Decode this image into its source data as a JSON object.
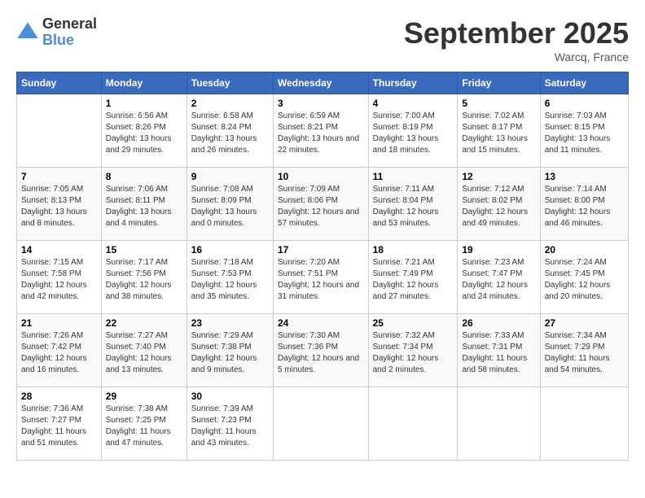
{
  "logo": {
    "general": "General",
    "blue": "Blue"
  },
  "title": "September 2025",
  "location": "Warcq, France",
  "days_header": [
    "Sunday",
    "Monday",
    "Tuesday",
    "Wednesday",
    "Thursday",
    "Friday",
    "Saturday"
  ],
  "weeks": [
    [
      {
        "day": "",
        "sunrise": "",
        "sunset": "",
        "daylight": ""
      },
      {
        "day": "1",
        "sunrise": "Sunrise: 6:56 AM",
        "sunset": "Sunset: 8:26 PM",
        "daylight": "Daylight: 13 hours and 29 minutes."
      },
      {
        "day": "2",
        "sunrise": "Sunrise: 6:58 AM",
        "sunset": "Sunset: 8:24 PM",
        "daylight": "Daylight: 13 hours and 26 minutes."
      },
      {
        "day": "3",
        "sunrise": "Sunrise: 6:59 AM",
        "sunset": "Sunset: 8:21 PM",
        "daylight": "Daylight: 13 hours and 22 minutes."
      },
      {
        "day": "4",
        "sunrise": "Sunrise: 7:00 AM",
        "sunset": "Sunset: 8:19 PM",
        "daylight": "Daylight: 13 hours and 18 minutes."
      },
      {
        "day": "5",
        "sunrise": "Sunrise: 7:02 AM",
        "sunset": "Sunset: 8:17 PM",
        "daylight": "Daylight: 13 hours and 15 minutes."
      },
      {
        "day": "6",
        "sunrise": "Sunrise: 7:03 AM",
        "sunset": "Sunset: 8:15 PM",
        "daylight": "Daylight: 13 hours and 11 minutes."
      }
    ],
    [
      {
        "day": "7",
        "sunrise": "Sunrise: 7:05 AM",
        "sunset": "Sunset: 8:13 PM",
        "daylight": "Daylight: 13 hours and 8 minutes."
      },
      {
        "day": "8",
        "sunrise": "Sunrise: 7:06 AM",
        "sunset": "Sunset: 8:11 PM",
        "daylight": "Daylight: 13 hours and 4 minutes."
      },
      {
        "day": "9",
        "sunrise": "Sunrise: 7:08 AM",
        "sunset": "Sunset: 8:09 PM",
        "daylight": "Daylight: 13 hours and 0 minutes."
      },
      {
        "day": "10",
        "sunrise": "Sunrise: 7:09 AM",
        "sunset": "Sunset: 8:06 PM",
        "daylight": "Daylight: 12 hours and 57 minutes."
      },
      {
        "day": "11",
        "sunrise": "Sunrise: 7:11 AM",
        "sunset": "Sunset: 8:04 PM",
        "daylight": "Daylight: 12 hours and 53 minutes."
      },
      {
        "day": "12",
        "sunrise": "Sunrise: 7:12 AM",
        "sunset": "Sunset: 8:02 PM",
        "daylight": "Daylight: 12 hours and 49 minutes."
      },
      {
        "day": "13",
        "sunrise": "Sunrise: 7:14 AM",
        "sunset": "Sunset: 8:00 PM",
        "daylight": "Daylight: 12 hours and 46 minutes."
      }
    ],
    [
      {
        "day": "14",
        "sunrise": "Sunrise: 7:15 AM",
        "sunset": "Sunset: 7:58 PM",
        "daylight": "Daylight: 12 hours and 42 minutes."
      },
      {
        "day": "15",
        "sunrise": "Sunrise: 7:17 AM",
        "sunset": "Sunset: 7:56 PM",
        "daylight": "Daylight: 12 hours and 38 minutes."
      },
      {
        "day": "16",
        "sunrise": "Sunrise: 7:18 AM",
        "sunset": "Sunset: 7:53 PM",
        "daylight": "Daylight: 12 hours and 35 minutes."
      },
      {
        "day": "17",
        "sunrise": "Sunrise: 7:20 AM",
        "sunset": "Sunset: 7:51 PM",
        "daylight": "Daylight: 12 hours and 31 minutes."
      },
      {
        "day": "18",
        "sunrise": "Sunrise: 7:21 AM",
        "sunset": "Sunset: 7:49 PM",
        "daylight": "Daylight: 12 hours and 27 minutes."
      },
      {
        "day": "19",
        "sunrise": "Sunrise: 7:23 AM",
        "sunset": "Sunset: 7:47 PM",
        "daylight": "Daylight: 12 hours and 24 minutes."
      },
      {
        "day": "20",
        "sunrise": "Sunrise: 7:24 AM",
        "sunset": "Sunset: 7:45 PM",
        "daylight": "Daylight: 12 hours and 20 minutes."
      }
    ],
    [
      {
        "day": "21",
        "sunrise": "Sunrise: 7:26 AM",
        "sunset": "Sunset: 7:42 PM",
        "daylight": "Daylight: 12 hours and 16 minutes."
      },
      {
        "day": "22",
        "sunrise": "Sunrise: 7:27 AM",
        "sunset": "Sunset: 7:40 PM",
        "daylight": "Daylight: 12 hours and 13 minutes."
      },
      {
        "day": "23",
        "sunrise": "Sunrise: 7:29 AM",
        "sunset": "Sunset: 7:38 PM",
        "daylight": "Daylight: 12 hours and 9 minutes."
      },
      {
        "day": "24",
        "sunrise": "Sunrise: 7:30 AM",
        "sunset": "Sunset: 7:36 PM",
        "daylight": "Daylight: 12 hours and 5 minutes."
      },
      {
        "day": "25",
        "sunrise": "Sunrise: 7:32 AM",
        "sunset": "Sunset: 7:34 PM",
        "daylight": "Daylight: 12 hours and 2 minutes."
      },
      {
        "day": "26",
        "sunrise": "Sunrise: 7:33 AM",
        "sunset": "Sunset: 7:31 PM",
        "daylight": "Daylight: 11 hours and 58 minutes."
      },
      {
        "day": "27",
        "sunrise": "Sunrise: 7:34 AM",
        "sunset": "Sunset: 7:29 PM",
        "daylight": "Daylight: 11 hours and 54 minutes."
      }
    ],
    [
      {
        "day": "28",
        "sunrise": "Sunrise: 7:36 AM",
        "sunset": "Sunset: 7:27 PM",
        "daylight": "Daylight: 11 hours and 51 minutes."
      },
      {
        "day": "29",
        "sunrise": "Sunrise: 7:38 AM",
        "sunset": "Sunset: 7:25 PM",
        "daylight": "Daylight: 11 hours and 47 minutes."
      },
      {
        "day": "30",
        "sunrise": "Sunrise: 7:39 AM",
        "sunset": "Sunset: 7:23 PM",
        "daylight": "Daylight: 11 hours and 43 minutes."
      },
      {
        "day": "",
        "sunrise": "",
        "sunset": "",
        "daylight": ""
      },
      {
        "day": "",
        "sunrise": "",
        "sunset": "",
        "daylight": ""
      },
      {
        "day": "",
        "sunrise": "",
        "sunset": "",
        "daylight": ""
      },
      {
        "day": "",
        "sunrise": "",
        "sunset": "",
        "daylight": ""
      }
    ]
  ]
}
